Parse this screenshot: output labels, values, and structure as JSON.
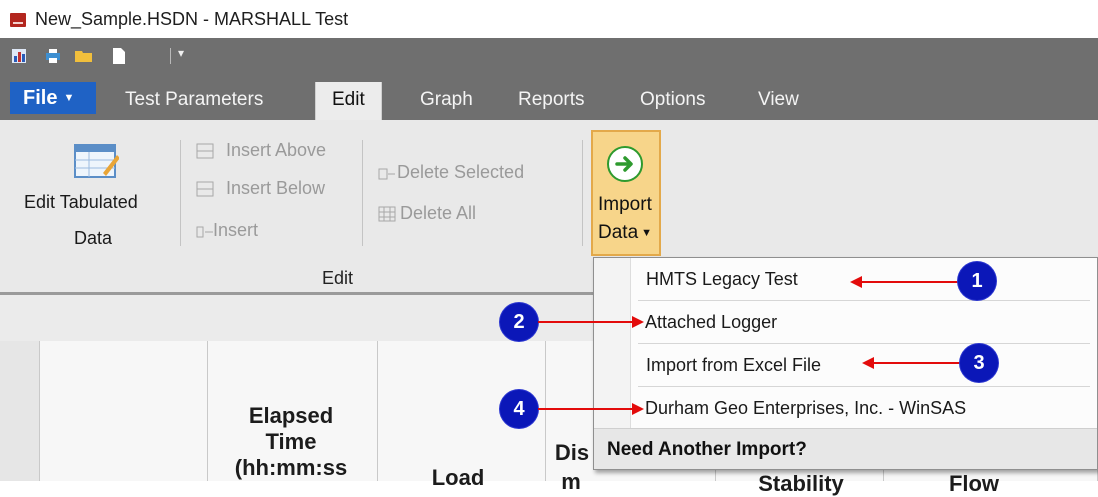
{
  "window": {
    "title": "New_Sample.HSDN - MARSHALL Test"
  },
  "tabs": {
    "file": "File",
    "items": [
      "Test Parameters",
      "Edit",
      "Graph",
      "Reports",
      "Options",
      "View"
    ],
    "active": "Edit"
  },
  "ribbon": {
    "edit_tabulated_line1": "Edit Tabulated",
    "edit_tabulated_line2": "Data",
    "insert_above": "Insert Above",
    "insert_below": "Insert Below",
    "insert": "Insert",
    "delete_selected": "Delete Selected",
    "delete_all": "Delete All",
    "import_line1": "Import",
    "import_line2": "Data",
    "group_label": "Edit"
  },
  "grid": {
    "header_elapsed_1": "Elapsed",
    "header_elapsed_2": "Time",
    "header_elapsed_3": "(hh:mm:ss",
    "header_load": "Load",
    "header_dis": "Dis",
    "header_dis_2": "m",
    "header_stability": "Stability",
    "header_flow": "Flow"
  },
  "menu": {
    "items": [
      "HMTS Legacy Test",
      "Attached Logger",
      "Import from Excel File",
      "Durham Geo Enterprises, Inc. - WinSAS"
    ],
    "footer": "Need Another Import?"
  },
  "callouts": [
    "1",
    "2",
    "3",
    "4"
  ],
  "colors": {
    "file_tab": "#1f62c5",
    "import_highlight": "#f7d58a",
    "badge": "#0b17b8",
    "arrow": "#e30b0b"
  }
}
